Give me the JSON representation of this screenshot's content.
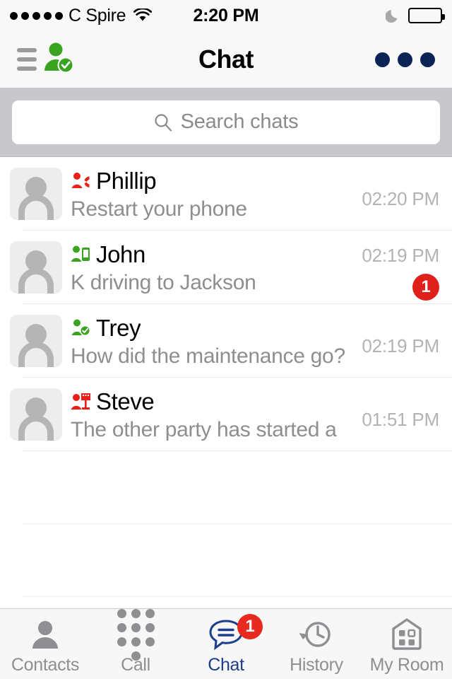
{
  "status_bar": {
    "carrier": "C Spire",
    "signal_dots": 5,
    "wifi_icon": "wifi-icon",
    "time": "2:20 PM",
    "dnd_icon": "moon-icon",
    "battery_icon": "battery-full-icon"
  },
  "nav_bar": {
    "menu_icon": "hamburger-menu-icon",
    "presence_avatar_icon": "person-available-icon",
    "title": "Chat",
    "more_icon": "more-options-icon"
  },
  "search": {
    "icon": "search-icon",
    "placeholder": "Search chats",
    "value": ""
  },
  "chat_list": {
    "rows": [
      {
        "name": "Phillip",
        "preview": "Restart your phone",
        "time": "02:20 PM",
        "presence": "on-call-red",
        "presence_icon": "presence-on-call-icon",
        "unread": ""
      },
      {
        "name": "John",
        "preview": "K driving to Jackson",
        "time": "02:19 PM",
        "presence": "mobile-green",
        "presence_icon": "presence-mobile-icon",
        "unread": "1"
      },
      {
        "name": "Trey",
        "preview": "How did the maintenance go?",
        "time": "02:19 PM",
        "presence": "available-green",
        "presence_icon": "presence-available-icon",
        "unread": ""
      },
      {
        "name": "Steve",
        "preview": "The other party has started a",
        "time": "01:51 PM",
        "presence": "busy-desktop-red",
        "presence_icon": "presence-busy-desktop-icon",
        "unread": ""
      }
    ]
  },
  "tab_bar": {
    "tabs": [
      {
        "label": "Contacts",
        "icon": "contacts-person-icon",
        "active": false,
        "badge": ""
      },
      {
        "label": "Call",
        "icon": "dialpad-icon",
        "active": false,
        "badge": ""
      },
      {
        "label": "Chat",
        "icon": "chat-bubble-icon",
        "active": true,
        "badge": "1"
      },
      {
        "label": "History",
        "icon": "clock-history-icon",
        "active": false,
        "badge": ""
      },
      {
        "label": "My Room",
        "icon": "house-room-icon",
        "active": false,
        "badge": ""
      }
    ]
  },
  "colors": {
    "accent_blue": "#1b3f8b",
    "nav_dots": "#0b2356",
    "badge_red": "#e0201b",
    "presence_green": "#3aa422",
    "presence_red": "#e8201a",
    "search_bg": "#c8c7cc",
    "tab_inactive": "#8e8e93"
  }
}
